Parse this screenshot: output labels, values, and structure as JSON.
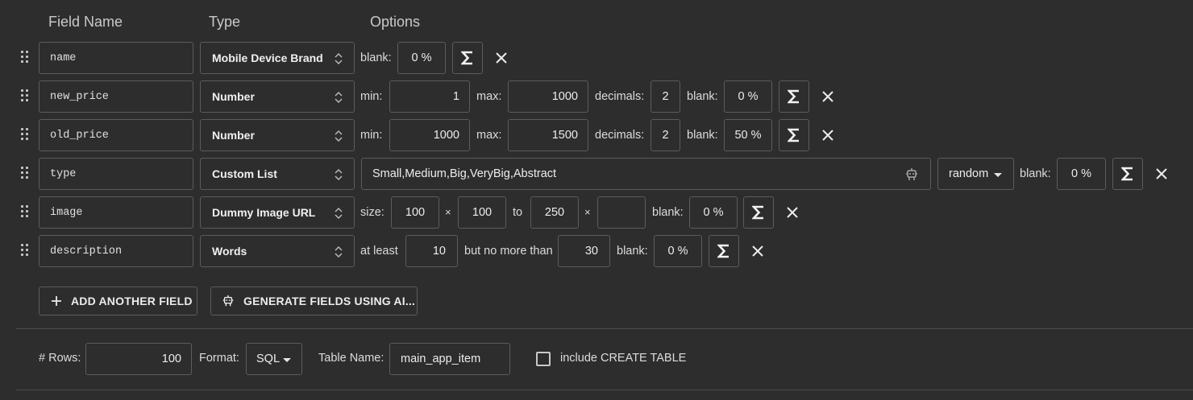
{
  "headers": {
    "field_name": "Field Name",
    "type": "Type",
    "options": "Options"
  },
  "fields": [
    {
      "name": "name",
      "type": "Mobile Device Brand",
      "blank_label": "blank:",
      "blank": "0 %"
    },
    {
      "name": "new_price",
      "type": "Number",
      "min_label": "min:",
      "min": "1",
      "max_label": "max:",
      "max": "1000",
      "decimals_label": "decimals:",
      "decimals": "2",
      "blank_label": "blank:",
      "blank": "0 %"
    },
    {
      "name": "old_price",
      "type": "Number",
      "min_label": "min:",
      "min": "1000",
      "max_label": "max:",
      "max": "1500",
      "decimals_label": "decimals:",
      "decimals": "2",
      "blank_label": "blank:",
      "blank": "50 %"
    },
    {
      "name": "type",
      "type": "Custom List",
      "values": "Small,Medium,Big,VeryBig,Abstract",
      "order": "random",
      "blank_label": "blank:",
      "blank": "0 %"
    },
    {
      "name": "image",
      "type": "Dummy Image URL",
      "size_label": "size:",
      "w1": "100",
      "x1": "×",
      "h1": "100",
      "to_label": "to",
      "w2": "250",
      "x2": "×",
      "h2": "",
      "blank_label": "blank:",
      "blank": "0 %"
    },
    {
      "name": "description",
      "type": "Words",
      "at_least_label": "at least",
      "at_least": "10",
      "no_more_label": "but no more than",
      "no_more": "30",
      "blank_label": "blank:",
      "blank": "0 %"
    }
  ],
  "buttons": {
    "add_field": "ADD ANOTHER FIELD",
    "generate_ai": "GENERATE FIELDS USING AI..."
  },
  "footer": {
    "rows_label": "# Rows:",
    "rows": "100",
    "format_label": "Format:",
    "format": "SQL",
    "table_name_label": "Table Name:",
    "table_name": "main_app_item",
    "create_table_label": "include CREATE TABLE",
    "create_table_checked": false
  },
  "icons": {
    "drag": "drag-handle-icon",
    "sort": "updown-icon",
    "formula": "sigma-icon",
    "delete": "close-icon",
    "ai": "robot-icon",
    "add": "plus-icon",
    "dropdown": "caret-down-icon"
  }
}
